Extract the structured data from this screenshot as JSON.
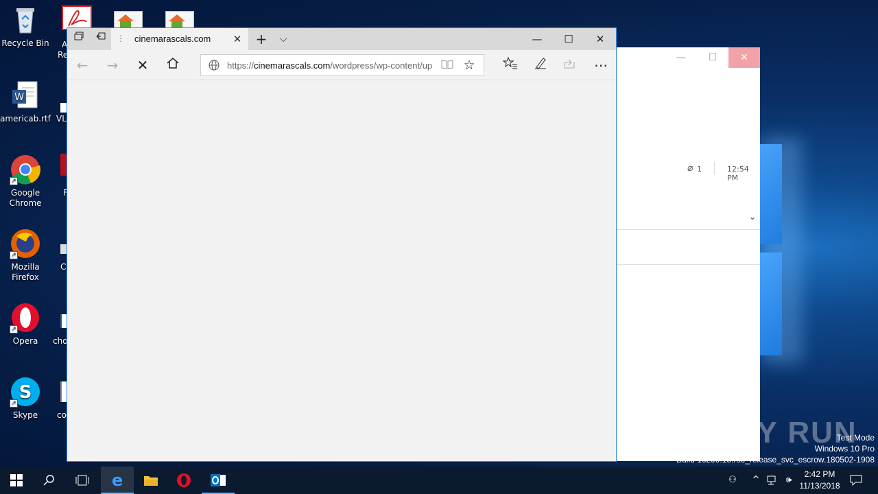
{
  "desktop": {
    "icons": [
      {
        "label": "Recycle Bin",
        "icon": "recycle-bin-icon"
      },
      {
        "label": "americab.rtf",
        "icon": "word-document-icon"
      },
      {
        "label": "Google Chrome",
        "icon": "chrome-icon"
      },
      {
        "label": "Mozilla Firefox",
        "icon": "firefox-icon"
      },
      {
        "label": "Opera",
        "icon": "opera-icon"
      },
      {
        "label": "Skype",
        "icon": "skype-icon"
      }
    ],
    "partial_labels": [
      "A",
      "Re",
      "VL",
      "F",
      "C",
      "cho",
      "co"
    ]
  },
  "background_window": {
    "attachment_count": "1",
    "time": "12:54 PM"
  },
  "edge": {
    "tab_title": "cinemarascals.com",
    "url_prefix": "https://",
    "url_host": "cinemarascals.com",
    "url_path": "/wordpress/wp-content/up",
    "accent": "#3a8be0"
  },
  "taskbar": {
    "time": "2:42 PM",
    "date": "11/13/2018"
  },
  "watermark": {
    "brand": "ANY RUN",
    "test_mode": "Test Mode",
    "edition": "Windows 10 Pro",
    "build": "Build 16299.15.rs3_release_svc_escrow.180502-1908"
  }
}
